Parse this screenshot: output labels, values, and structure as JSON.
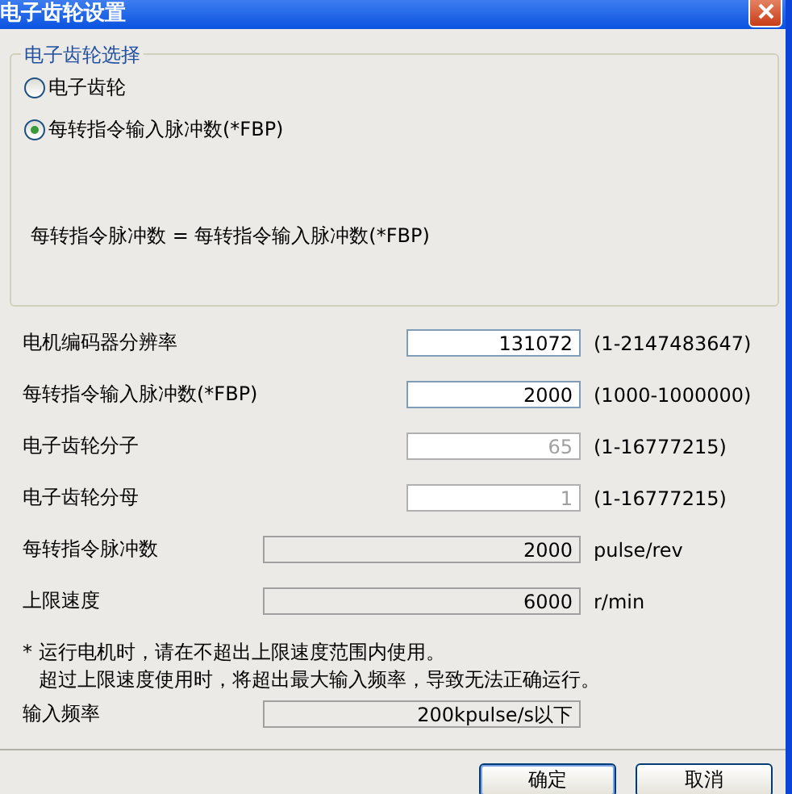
{
  "window": {
    "title": "电子齿轮设置"
  },
  "gear_selection": {
    "legend": "电子齿轮选择",
    "options": [
      {
        "label": "电子齿轮",
        "selected": false
      },
      {
        "label": "每转指令输入脉冲数(*FBP)",
        "selected": true
      }
    ],
    "formula": "每转指令脉冲数 = 每转指令输入脉冲数(*FBP)"
  },
  "fields": [
    {
      "kind": "input",
      "label": "电机编码器分辨率",
      "value": "131072",
      "range": "(1-2147483647)"
    },
    {
      "kind": "input",
      "label": "每转指令输入脉冲数(*FBP)",
      "value": "2000",
      "range": "(1000-1000000)"
    },
    {
      "kind": "disabled",
      "label": "电子齿轮分子",
      "value": "65",
      "range": "(1-16777215)"
    },
    {
      "kind": "disabled",
      "label": "电子齿轮分母",
      "value": "1",
      "range": "(1-16777215)"
    },
    {
      "kind": "readonly",
      "label": "每转指令脉冲数",
      "value": "2000",
      "unit": "pulse/rev"
    },
    {
      "kind": "readonly",
      "label": "上限速度",
      "value": "6000",
      "unit": "r/min"
    }
  ],
  "note": [
    "* 运行电机时，请在不超出上限速度范围内使用。",
    "超过上限速度使用时，将超出最大输入频率，导致无法正确运行。"
  ],
  "input_frequency": {
    "label": "输入频率",
    "value": "200kpulse/s以下"
  },
  "buttons": [
    "确定",
    "取消"
  ]
}
